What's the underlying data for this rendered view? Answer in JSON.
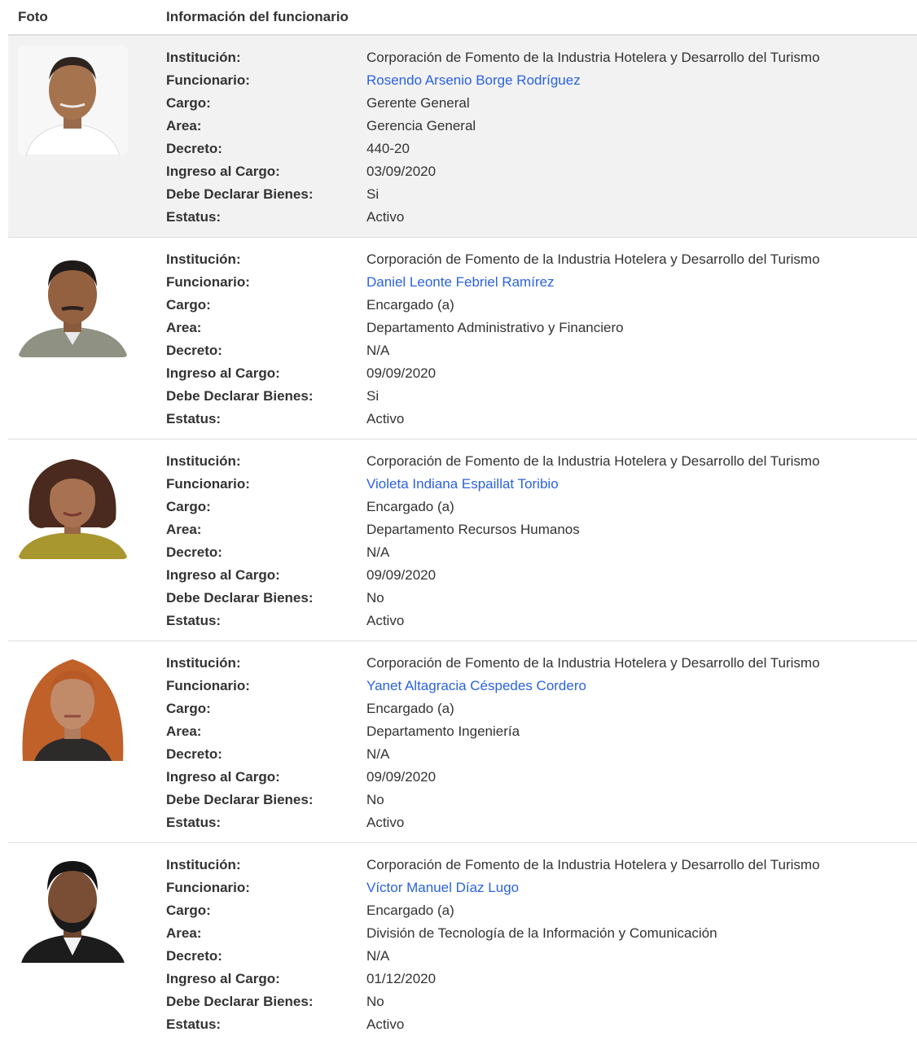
{
  "header": {
    "photo_col": "Foto",
    "info_col": "Información del funcionario"
  },
  "labels": {
    "institucion": "Institución:",
    "funcionario": "Funcionario:",
    "cargo": "Cargo:",
    "area": "Area:",
    "decreto": "Decreto:",
    "ingreso": "Ingreso al Cargo:",
    "declarar": "Debe Declarar Bienes:",
    "estatus": "Estatus:"
  },
  "colors": {
    "link": "#2a62e0",
    "row_shade": "#f2f2f2",
    "divider": "#dddddd"
  },
  "rows": [
    {
      "institucion": "Corporación de Fomento de la Industria Hotelera y Desarrollo del Turismo",
      "funcionario": "Rosendo Arsenio Borge Rodríguez",
      "cargo": "Gerente General",
      "area": "Gerencia General",
      "decreto": "440-20",
      "ingreso": "03/09/2020",
      "declarar": "Si",
      "estatus": "Activo"
    },
    {
      "institucion": "Corporación de Fomento de la Industria Hotelera y Desarrollo del Turismo",
      "funcionario": "Daniel Leonte Febriel Ramírez",
      "cargo": "Encargado (a)",
      "area": "Departamento Administrativo y Financiero",
      "decreto": "N/A",
      "ingreso": "09/09/2020",
      "declarar": "Si",
      "estatus": "Activo"
    },
    {
      "institucion": "Corporación de Fomento de la Industria Hotelera y Desarrollo del Turismo",
      "funcionario": "Violeta Indiana Espaillat Toribio",
      "cargo": "Encargado (a)",
      "area": "Departamento Recursos Humanos",
      "decreto": "N/A",
      "ingreso": "09/09/2020",
      "declarar": "No",
      "estatus": "Activo"
    },
    {
      "institucion": "Corporación de Fomento de la Industria Hotelera y Desarrollo del Turismo",
      "funcionario": "Yanet Altagracia Céspedes Cordero",
      "cargo": "Encargado (a)",
      "area": "Departamento Ingeniería",
      "decreto": "N/A",
      "ingreso": "09/09/2020",
      "declarar": "No",
      "estatus": "Activo"
    },
    {
      "institucion": "Corporación de Fomento de la Industria Hotelera y Desarrollo del Turismo",
      "funcionario": "Víctor Manuel Díaz Lugo",
      "cargo": "Encargado (a)",
      "area": "División de Tecnología de la Información y Comunicación",
      "decreto": "N/A",
      "ingreso": "01/12/2020",
      "declarar": "No",
      "estatus": "Activo"
    }
  ]
}
